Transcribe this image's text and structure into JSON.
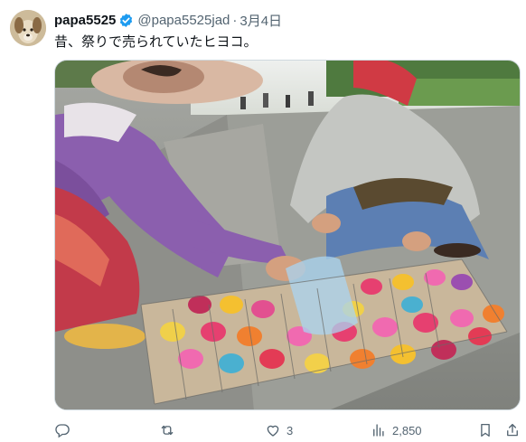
{
  "tweet": {
    "display_name": "papa5525",
    "verified_icon": "verified-badge-icon",
    "handle": "@papa5525jad",
    "separator": "·",
    "date": "3月4日",
    "text": "昔、祭りで売られていたヒヨコ。",
    "media_icon": "photo-colored-chicks"
  },
  "actions": {
    "reply": {
      "icon": "reply-icon",
      "count": ""
    },
    "retweet": {
      "icon": "retweet-icon",
      "count": ""
    },
    "like": {
      "icon": "heart-icon",
      "count": "3"
    },
    "views": {
      "icon": "views-icon",
      "count": "2,850"
    },
    "bookmark": {
      "icon": "bookmark-icon"
    },
    "share": {
      "icon": "share-icon"
    }
  },
  "colors": {
    "text": "#0f1419",
    "secondary": "#536471",
    "verified": "#1d9bf0",
    "border": "#cfd9de"
  }
}
